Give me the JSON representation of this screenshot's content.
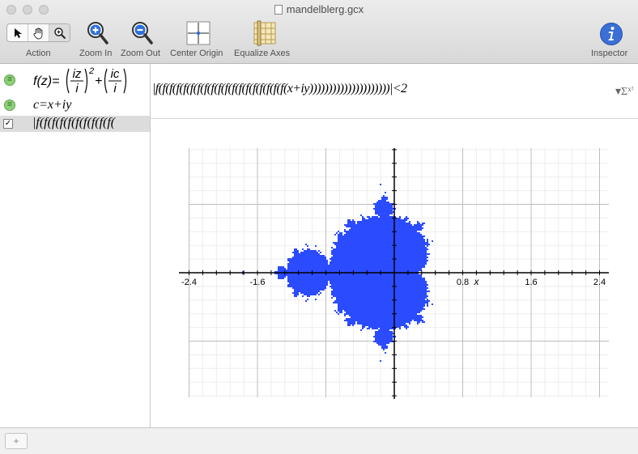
{
  "window": {
    "title": "mandelblerg.gcx"
  },
  "toolbar": {
    "action_label": "Action",
    "zoom_in_label": "Zoom In",
    "zoom_out_label": "Zoom Out",
    "center_origin_label": "Center Origin",
    "equalize_axes_label": "Equalize Axes",
    "inspector_label": "Inspector",
    "icons": [
      "arrow-cursor-icon",
      "hand-icon",
      "magnifier-icon",
      "zoom-in-icon",
      "zoom-out-icon",
      "center-origin-icon",
      "equalize-axes-icon",
      "info-icon"
    ]
  },
  "sidebar": {
    "equations": [
      {
        "display": "f(z)=(iz/i)²+(ic/i)",
        "parts": {
          "lhs": "f(z)=",
          "num1": "iz",
          "den1": "i",
          "exp": "2",
          "plus": "+",
          "num2": "ic",
          "den2": "i"
        },
        "enabled": true
      },
      {
        "display": "c=x+iy",
        "enabled": true
      },
      {
        "display": "|f(f(f(f(f(f(f(f(f(f(",
        "checked": true,
        "selected": true
      }
    ]
  },
  "expression_bar": {
    "text": "|f(f(f(f(f(f(f(f(f(f(f(f(f(f(f(f(f(f(f(x+iy)))))))))))))))))))))|<2",
    "sigma_icon": "sigma-icon"
  },
  "graph": {
    "x_ticks": [
      "-2.4",
      "-1.6",
      "0.8",
      "1.6",
      "2.4"
    ],
    "x_axis_label": "x",
    "fill_color": "#2b4bff",
    "grid_color": "#d9d9d9"
  },
  "bottom_bar": {
    "add_label": "+"
  }
}
